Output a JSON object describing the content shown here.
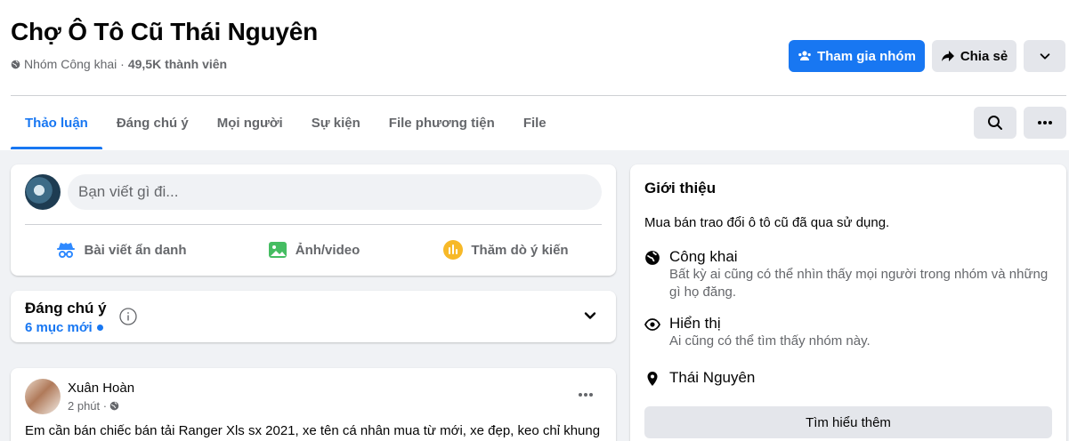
{
  "group": {
    "title": "Chợ Ô Tô Cũ Thái Nguyên",
    "privacy": "Nhóm Công khai ·",
    "members": "49,5K thành viên"
  },
  "actions": {
    "join_label": "Tham gia nhóm",
    "share_label": "Chia sẻ"
  },
  "tabs": [
    {
      "label": "Thảo luận",
      "active": true
    },
    {
      "label": "Đáng chú ý",
      "active": false
    },
    {
      "label": "Mọi người",
      "active": false
    },
    {
      "label": "Sự kiện",
      "active": false
    },
    {
      "label": "File phương tiện",
      "active": false
    },
    {
      "label": "File",
      "active": false
    }
  ],
  "composer": {
    "placeholder": "Bạn viết gì đi...",
    "actions": [
      {
        "label": "Bài viết ẩn danh",
        "icon": "anonymous-icon"
      },
      {
        "label": "Ảnh/video",
        "icon": "photo-video-icon"
      },
      {
        "label": "Thăm dò ý kiến",
        "icon": "poll-icon"
      }
    ]
  },
  "featured": {
    "title": "Đáng chú ý",
    "new_items": "6 mục mới"
  },
  "post": {
    "author": "Xuân Hoàn",
    "time": "2 phút ·",
    "text": "Em cần bán chiếc bán tải Ranger Xls sx 2021, xe tên cá nhân mua từ mới, xe đẹp, keo chỉ khung"
  },
  "about": {
    "title": "Giới thiệu",
    "description": "Mua bán trao đổi ô tô cũ đã qua sử dụng.",
    "items": [
      {
        "title": "Công khai",
        "detail": "Bất kỳ ai cũng có thể nhìn thấy mọi người trong nhóm và những gì họ đăng.",
        "icon": "globe-icon"
      },
      {
        "title": "Hiển thị",
        "detail": "Ai cũng có thể tìm thấy nhóm này.",
        "icon": "eye-icon"
      },
      {
        "title": "Thái Nguyên",
        "detail": "",
        "icon": "location-pin-icon"
      }
    ],
    "learn_more": "Tìm hiểu thêm"
  },
  "colors": {
    "accent": "#1877f2",
    "secondary_button": "#e4e6eb",
    "page_background": "#f0f2f5",
    "muted_text": "#65676b"
  }
}
